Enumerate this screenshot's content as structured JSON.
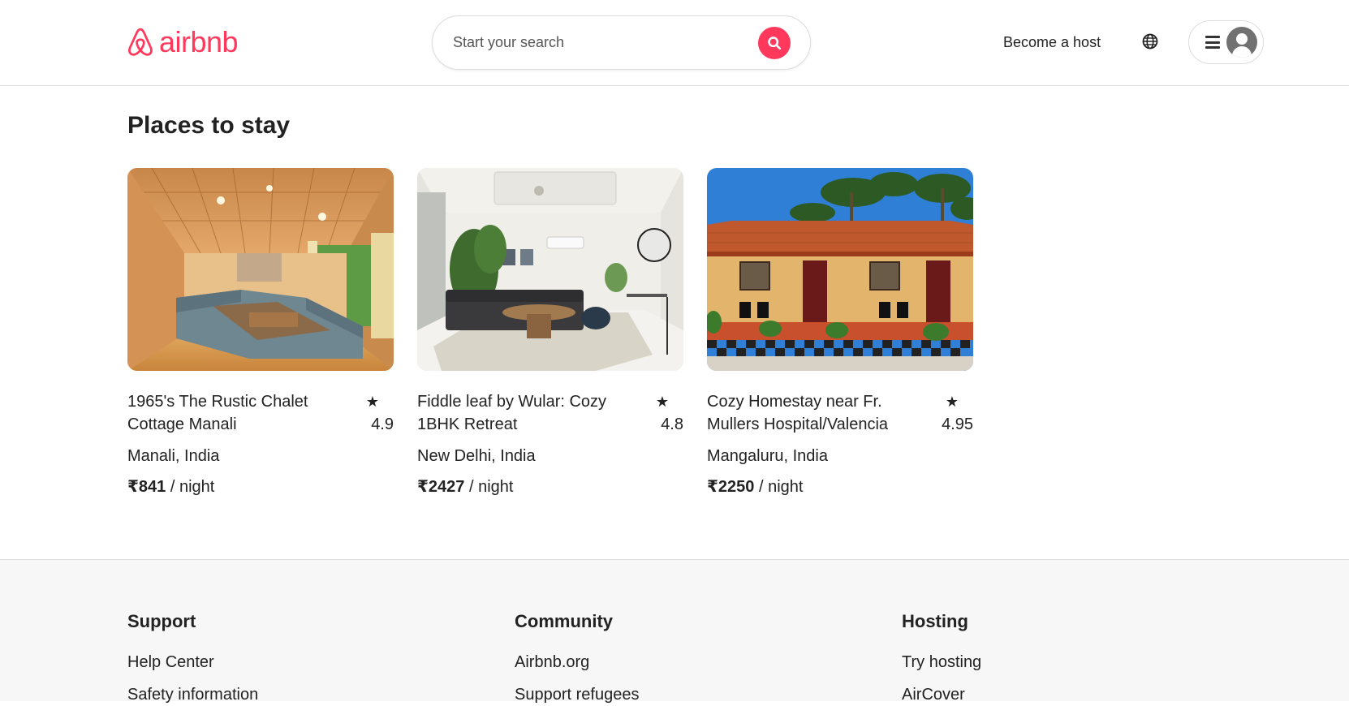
{
  "header": {
    "logo_text": "airbnb",
    "brand_color": "#ff385c",
    "search_placeholder": "Start your search",
    "become_host": "Become a host"
  },
  "main": {
    "section_title": "Places to stay",
    "listings": [
      {
        "title": "1965's The Rustic Chalet Cottage Manali",
        "rating_star": "★",
        "rating": "4.9",
        "location": "Manali, India",
        "price": "₹841",
        "price_unit": " / night"
      },
      {
        "title": "Fiddle leaf by Wular: Cozy 1BHK Retreat",
        "rating_star": "★",
        "rating": "4.8",
        "location": "New Delhi, India",
        "price": "₹2427",
        "price_unit": " / night"
      },
      {
        "title": "Cozy Homestay near Fr. Mullers Hospital/Valencia",
        "rating_star": "★",
        "rating": "4.95",
        "location": "Mangaluru, India",
        "price": "₹2250",
        "price_unit": " / night"
      }
    ]
  },
  "footer": {
    "columns": [
      {
        "heading": "Support",
        "links": [
          "Help Center",
          "Safety information"
        ]
      },
      {
        "heading": "Community",
        "links": [
          "Airbnb.org",
          "Support refugees"
        ]
      },
      {
        "heading": "Hosting",
        "links": [
          "Try hosting",
          "AirCover"
        ]
      }
    ]
  }
}
